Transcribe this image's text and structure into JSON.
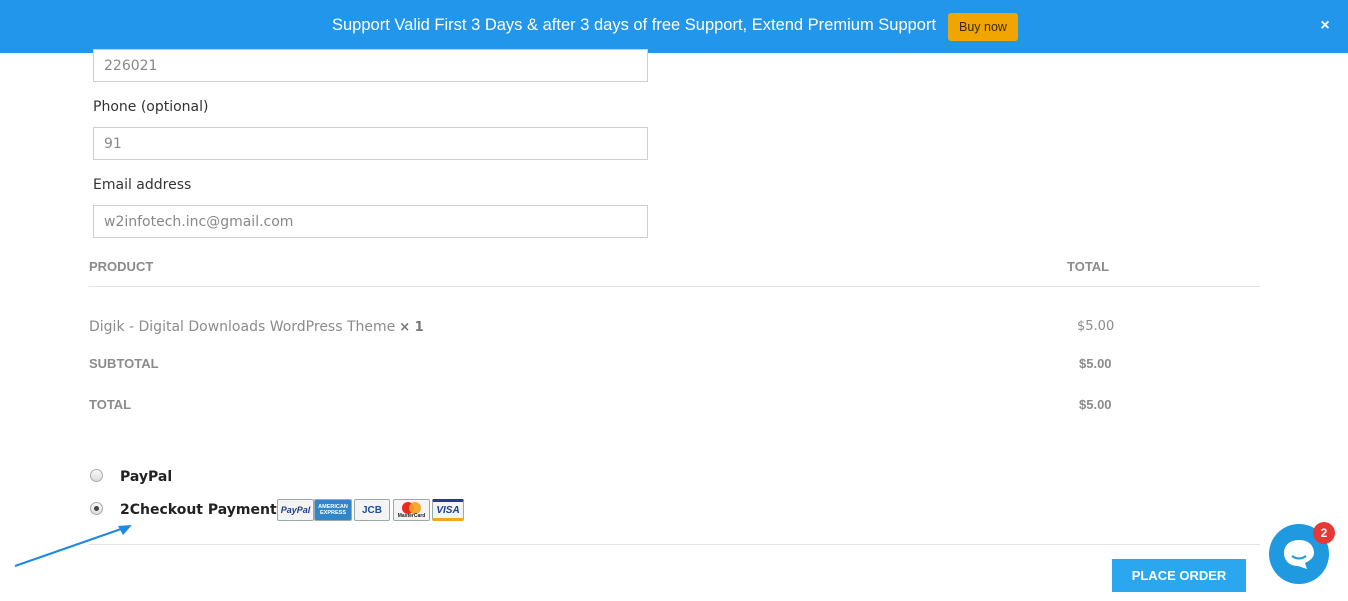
{
  "banner": {
    "message": "Support Valid First 3 Days & after 3 days of free Support, Extend Premium Support",
    "buy_label": "Buy now",
    "close_label": "×",
    "bg_color": "#2196ea",
    "button_color": "#f0a500"
  },
  "form": {
    "postcode_value": "226021",
    "phone_label": "Phone (optional)",
    "phone_value": "91",
    "email_label": "Email address",
    "email_value": "w2infotech.inc@gmail.com"
  },
  "order": {
    "headers": {
      "product": "PRODUCT",
      "total": "TOTAL"
    },
    "items": [
      {
        "name": "Digik - Digital Downloads WordPress Theme",
        "qty": "× 1",
        "total": "$5.00"
      }
    ],
    "subtotal_label": "SUBTOTAL",
    "subtotal_value": "$5.00",
    "total_label": "TOTAL",
    "total_value": "$5.00"
  },
  "payment": {
    "methods": [
      {
        "label": "PayPal",
        "selected": false
      },
      {
        "label": "2Checkout Payment",
        "selected": true
      }
    ],
    "cards": [
      {
        "icon": "paypal-card-icon",
        "text": "PayPal"
      },
      {
        "icon": "amex-card-icon",
        "text": "AMERICAN EXPRESS"
      },
      {
        "icon": "jcb-card-icon",
        "text": "JCB"
      },
      {
        "icon": "mastercard-card-icon",
        "text": "MasterCard"
      },
      {
        "icon": "visa-card-icon",
        "text": "VISA"
      }
    ]
  },
  "place_order_label": "PLACE ORDER",
  "chat": {
    "badge_count": "2",
    "icon": "chat-bubble-icon",
    "color": "#1f9ae0"
  }
}
